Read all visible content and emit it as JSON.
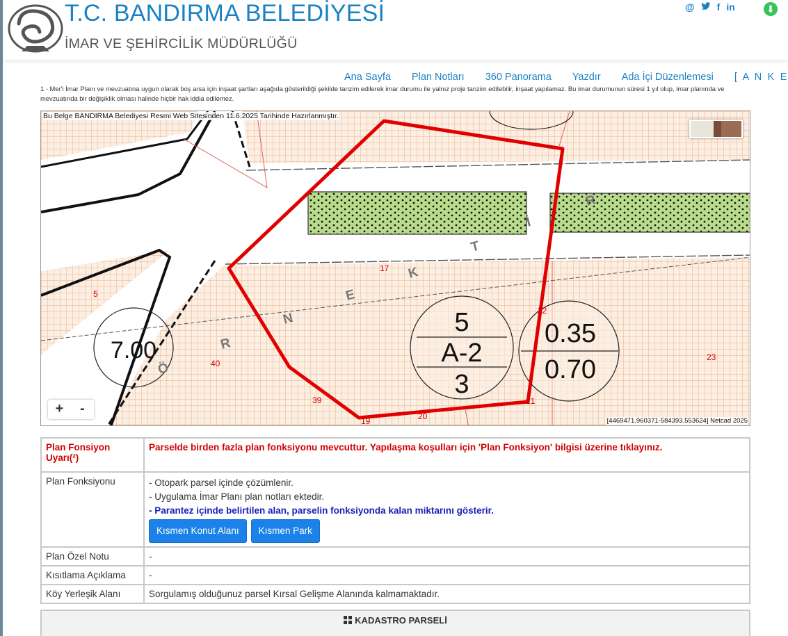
{
  "header": {
    "title": "T.C. BANDIRMA BELEDİYESİ",
    "subtitle": "İMAR VE ŞEHİRCİLİK MÜDÜRLÜĞÜ",
    "social_icons": [
      "email-icon",
      "twitter-icon",
      "facebook-icon",
      "linkedin-icon"
    ],
    "social_glyphs": [
      "@",
      "🐦",
      "f",
      "in"
    ],
    "download_icon": "download-icon"
  },
  "nav": {
    "items": [
      "Ana Sayfa",
      "Plan Notları",
      "360 Panorama",
      "Yazdır",
      "Ada İçi Düzenlemesi",
      "[ A N K E T ]"
    ]
  },
  "notice": "1 - Mer'i İmar Planı ve mevzuatına uygun olarak boş arsa için inşaat şartları aşağıda gösterildiği şekilde tanzim edilerek imar durumu ile yalnız proje tanzim edilebilir, inşaat yapılamaz. Bu imar durumunun süresi 1 yıl olup, imar planında ve mevzuatında bir değişiklik olması halinde hiçbir hak iddia edilemez.",
  "map": {
    "caption": "Bu Belge BANDIRMA Belediyesi Resmi Web Sitesinden 11.6.2025 Tarihinde Hazırlanmıştır.",
    "coords": "[4469471.960371-584393.553624] Netcad 2025",
    "zoom_in": "+",
    "zoom_out": "-",
    "labels": {
      "zone_top": "5",
      "zone_mid": "A-2",
      "zone_bot": "3",
      "ratio_top": "0.35",
      "ratio_bot": "0.70",
      "circle_left": "7.00",
      "parcel_17": "17",
      "parcel_5": "5",
      "parcel_22": "22",
      "parcel_40": "40",
      "parcel_39": "39",
      "parcel_21": "21",
      "parcel_20": "20",
      "parcel_19": "19",
      "parcel_23": "23",
      "street": [
        "Ö",
        "R",
        "N",
        "E",
        "K",
        "T",
        "İ",
        "R"
      ]
    },
    "colors": {
      "parcel_outline": "#e00000",
      "green_area": "#b8dc8c",
      "grid": "#f0a070",
      "background": "#fbeee2"
    }
  },
  "info": {
    "warning_label": "Plan Fonsiyon Uyarı(²)",
    "warning_text": "Parselde birden fazla plan fonksiyonu mevcuttur. Yapılaşma koşulları için 'Plan Fonksiyon' bilgisi üzerine tıklayınız.",
    "function_label": "Plan Fonksiyonu",
    "function_lines": [
      "- Otopark parsel içinde çözümlenir.",
      "- Uygulama İmar Planı plan notları ektedir."
    ],
    "function_note": "- Parantez içinde belirtilen alan, parselin fonksiyonda kalan miktarını gösterir.",
    "buttons": [
      "Kısmen Konut Alanı",
      "Kısmen Park"
    ],
    "special_label": "Plan Özel Notu",
    "special_value": "-",
    "restriction_label": "Kısıtlama Açıklama",
    "restriction_value": "-",
    "village_label": "Köy Yerleşik Alanı",
    "village_value": "Sorgulamış olduğunuz parsel Kırsal Gelişme Alanında kalmamaktadır."
  },
  "kadastro": {
    "title": "KADASTRO PARSELİ"
  }
}
